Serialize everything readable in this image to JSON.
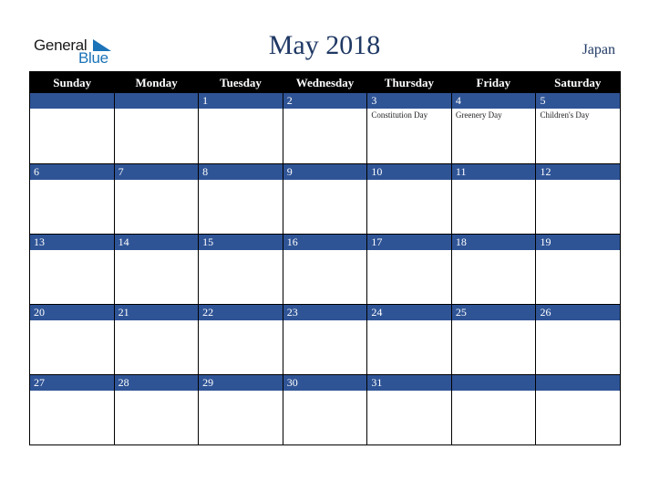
{
  "logo": {
    "text_general": "General",
    "text_blue": "Blue"
  },
  "title": "May 2018",
  "country": "Japan",
  "weekdays": [
    "Sunday",
    "Monday",
    "Tuesday",
    "Wednesday",
    "Thursday",
    "Friday",
    "Saturday"
  ],
  "weeks": [
    [
      {
        "day": "",
        "event": ""
      },
      {
        "day": "",
        "event": ""
      },
      {
        "day": "1",
        "event": ""
      },
      {
        "day": "2",
        "event": ""
      },
      {
        "day": "3",
        "event": "Constitution Day"
      },
      {
        "day": "4",
        "event": "Greenery Day"
      },
      {
        "day": "5",
        "event": "Children's Day"
      }
    ],
    [
      {
        "day": "6",
        "event": ""
      },
      {
        "day": "7",
        "event": ""
      },
      {
        "day": "8",
        "event": ""
      },
      {
        "day": "9",
        "event": ""
      },
      {
        "day": "10",
        "event": ""
      },
      {
        "day": "11",
        "event": ""
      },
      {
        "day": "12",
        "event": ""
      }
    ],
    [
      {
        "day": "13",
        "event": ""
      },
      {
        "day": "14",
        "event": ""
      },
      {
        "day": "15",
        "event": ""
      },
      {
        "day": "16",
        "event": ""
      },
      {
        "day": "17",
        "event": ""
      },
      {
        "day": "18",
        "event": ""
      },
      {
        "day": "19",
        "event": ""
      }
    ],
    [
      {
        "day": "20",
        "event": ""
      },
      {
        "day": "21",
        "event": ""
      },
      {
        "day": "22",
        "event": ""
      },
      {
        "day": "23",
        "event": ""
      },
      {
        "day": "24",
        "event": ""
      },
      {
        "day": "25",
        "event": ""
      },
      {
        "day": "26",
        "event": ""
      }
    ],
    [
      {
        "day": "27",
        "event": ""
      },
      {
        "day": "28",
        "event": ""
      },
      {
        "day": "29",
        "event": ""
      },
      {
        "day": "30",
        "event": ""
      },
      {
        "day": "31",
        "event": ""
      },
      {
        "day": "",
        "event": ""
      },
      {
        "day": "",
        "event": ""
      }
    ]
  ],
  "colors": {
    "header_bg": "#000000",
    "day_bar": "#2f5496",
    "title": "#1f3864",
    "logo_blue": "#1b73b8"
  }
}
